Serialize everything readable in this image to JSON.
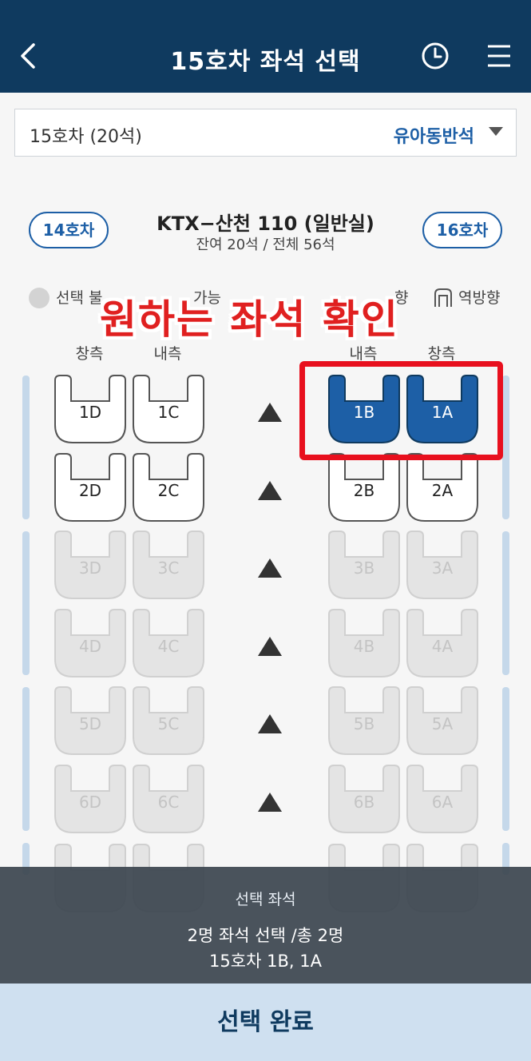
{
  "header": {
    "title": "15호차 좌석 선택"
  },
  "car_selector": {
    "label": "15호차 (20석)",
    "option": "유아동반석"
  },
  "train": {
    "prev_car": "14호차",
    "next_car": "16호차",
    "name": "KTX−산천 110 (일반실)",
    "seats": "잔여 20석 / 전체 56석"
  },
  "legend": {
    "unavailable": "선택 불",
    "available": "가능",
    "forward": "향",
    "reverse": "역방향"
  },
  "overlay": "원하는 좌석 확인",
  "columns": {
    "left_window": "창측",
    "left_aisle": "내측",
    "right_aisle": "내측",
    "right_window": "창측"
  },
  "rows": [
    {
      "D": "1D",
      "C": "1C",
      "B": "1B",
      "A": "1A",
      "state": [
        "available",
        "available",
        "selected",
        "selected"
      ]
    },
    {
      "D": "2D",
      "C": "2C",
      "B": "2B",
      "A": "2A",
      "state": [
        "available",
        "available",
        "available",
        "available"
      ]
    },
    {
      "D": "3D",
      "C": "3C",
      "B": "3B",
      "A": "3A",
      "state": [
        "taken",
        "taken",
        "taken",
        "taken"
      ]
    },
    {
      "D": "4D",
      "C": "4C",
      "B": "4B",
      "A": "4A",
      "state": [
        "taken",
        "taken",
        "taken",
        "taken"
      ]
    },
    {
      "D": "5D",
      "C": "5C",
      "B": "5B",
      "A": "5A",
      "state": [
        "taken",
        "taken",
        "taken",
        "taken"
      ]
    },
    {
      "D": "6D",
      "C": "6C",
      "B": "6B",
      "A": "6A",
      "state": [
        "taken",
        "taken",
        "taken",
        "taken"
      ]
    }
  ],
  "summary": {
    "title": "선택 좌석",
    "count": "2명 좌석 선택 /총 2명",
    "seats": "15호차 1B, 1A"
  },
  "complete_button": "선택 완료",
  "colors": {
    "header_bg": "#0f3a5f",
    "accent": "#1d5fa6",
    "selected_seat": "#1d5fa6",
    "highlight": "#e8101e",
    "complete_bg": "#cfe0f0"
  }
}
